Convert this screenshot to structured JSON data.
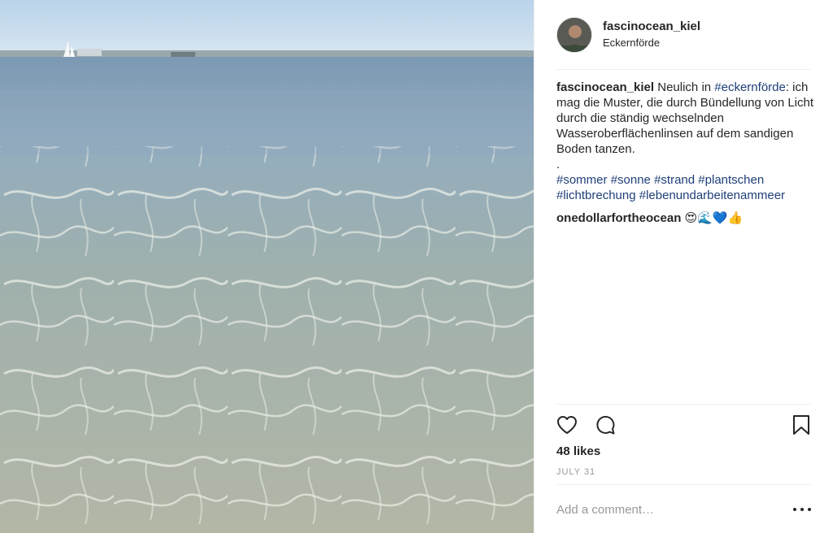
{
  "post": {
    "username": "fascinocean_kiel",
    "location": "Eckernförde",
    "photo_icon": "beach-water-photo"
  },
  "caption": {
    "username": "fascinocean_kiel",
    "text_before": " Neulich in ",
    "hashtag_location": "#eckernförde",
    "text_after": ": ich mag die Muster, die durch Bündellung von Licht durch die ständig wechselnden Wasseroberflächenlinsen auf dem sandigen Boden tanzen.",
    "dot": ".",
    "hashtags": [
      "#sommer",
      "#sonne",
      "#strand",
      "#plantschen",
      "#lichtbrechung",
      "#lebenundarbeitenammeer"
    ]
  },
  "comment": {
    "username": "onedollarfortheocean",
    "emojis": "😍🌊💙👍"
  },
  "actions": {
    "icons": [
      "heart-icon",
      "comment-icon",
      "bookmark-icon"
    ]
  },
  "likes": "48 likes",
  "date": "JULY 31",
  "add_comment": {
    "placeholder": "Add a comment…"
  },
  "colors": {
    "hashtag": "#1f3f79",
    "muted": "#999999",
    "text": "#262626"
  }
}
